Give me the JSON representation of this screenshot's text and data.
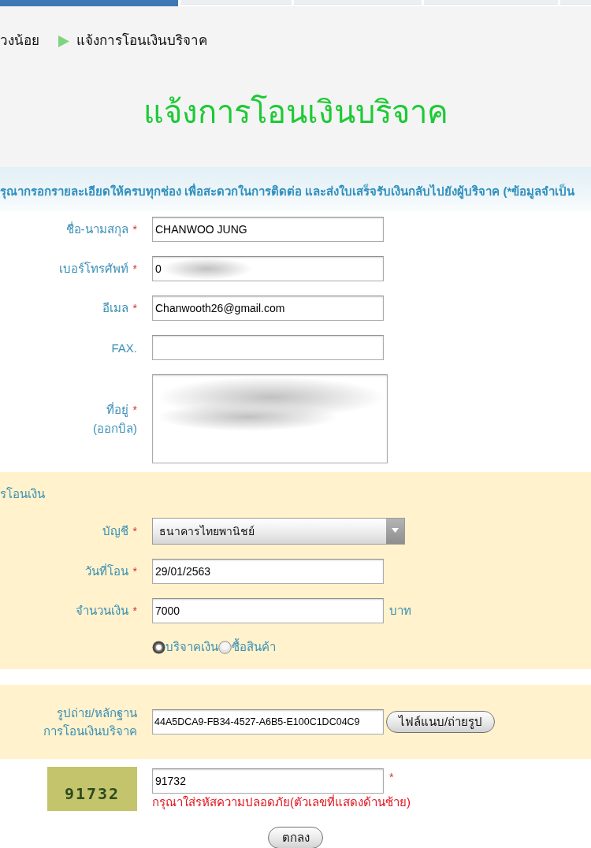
{
  "nav_tabs": [
    {
      "selected": true
    },
    {
      "selected": false
    },
    {
      "selected": false
    },
    {
      "selected": false
    },
    {
      "selected": false
    }
  ],
  "breadcrumb": [
    "วงน้อย",
    "แจ้งการโอนเงินบริจาค"
  ],
  "page_title": "แจ้งการโอนเงินบริจาค",
  "notice": "รุณากรอกรายละเอียดให้ครบทุกช่อง เพื่อสะดวกในการติดต่อ และส่งใบเสร็จรับเงินกลับไปยังผู้บริจาค (*ข้อมูลจำเป็น",
  "sections": [
    {
      "kind": "plain",
      "fields": [
        {
          "kind": "input",
          "label": "ชื่อ-นามสกุล",
          "mark": "*",
          "value": "CHANWOO JUNG",
          "redacted": false
        },
        {
          "kind": "input",
          "label": "เบอร์โทรศัพท์",
          "mark": "*",
          "value": "0",
          "redacted": true
        },
        {
          "kind": "input",
          "label": "อีเมล",
          "mark": "*",
          "value": "Chanwooth26@gmail.com",
          "redacted": false
        },
        {
          "kind": "input",
          "label": "FAX.",
          "redacted": false
        },
        {
          "kind": "textarea",
          "label": "ที่อยู่",
          "mark": "*",
          "sublabel": "(ออกบิล)",
          "redacted": true
        }
      ]
    },
    {
      "kind": "highlighted",
      "title": "รโอนเงิน",
      "fields": [
        {
          "kind": "select",
          "label": "บัญชี",
          "mark": "*",
          "value": "ธนาคารไทยพานิชย์"
        },
        {
          "kind": "input",
          "label": "วันที่โอน",
          "mark": "*",
          "value": "29/01/2563"
        },
        {
          "kind": "input",
          "label": "จำนวนเงิน",
          "mark": "*",
          "value": "7000",
          "unit": "บาท"
        },
        {
          "kind": "radios",
          "options": [
            {
              "label": "บริจาคเงิน",
              "selected": true
            },
            {
              "label": "ซื้อสินค้า",
              "selected": false
            }
          ]
        }
      ]
    },
    {
      "kind": "highlighted",
      "fields": [
        {
          "kind": "file",
          "label": "รูปถ่าย/หลักฐาน",
          "sublabel": "การโอนเงินบริจาค",
          "value": "44A5DCA9-FB34-4527-A6B5-E100C1DC04C9",
          "button": "ไฟล์แนบ/ถ่ายรูป"
        }
      ]
    }
  ],
  "captcha": {
    "code": "91732",
    "value": "91732",
    "mark": "*",
    "hint": "กรุณาใส่รหัสความปลอดภัย(ตัวเลขที่แสดงด้านซ้าย)"
  },
  "submit_button": "ตกลง"
}
